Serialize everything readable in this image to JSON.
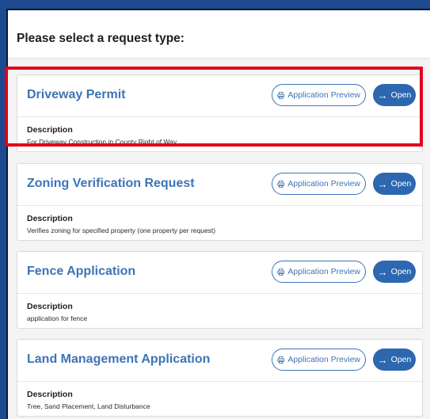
{
  "modal": {
    "title": "Please select a request type:"
  },
  "buttons": {
    "preview_label": "Application Preview",
    "open_label": "Open"
  },
  "description_label": "Description",
  "requests": [
    {
      "title": "Driveway Permit",
      "description": "For Driveway Construction in County Right of Way"
    },
    {
      "title": "Zoning Verification Request",
      "description": "Verifies zoning for specified property (one property per request)"
    },
    {
      "title": "Fence Application",
      "description": "application for fence"
    },
    {
      "title": "Land Management Application",
      "description": "Tree, Sand Placement, Land Disturbance"
    }
  ],
  "colors": {
    "page_background": "#1d4a8f",
    "accent": "#2d67b0",
    "title_blue": "#3d74b5",
    "highlight": "#e2001a"
  },
  "icons": {
    "preview": "printer-icon",
    "open": "arrow-right-icon"
  }
}
